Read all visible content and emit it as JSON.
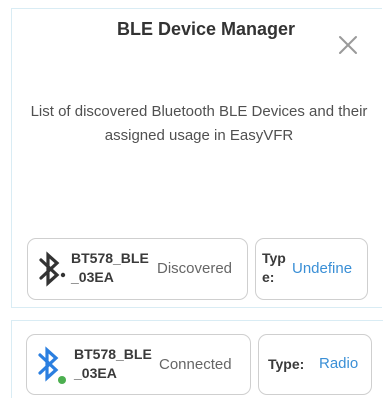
{
  "dialog": {
    "title": "BLE Device Manager",
    "description": "List of discovered Bluetooth BLE Devices and their assigned usage in EasyVFR"
  },
  "devices": [
    {
      "name": "BT578_BLE_03EA",
      "status": "Discovered",
      "icon": "bluetooth-icon",
      "icon_color": "#333333",
      "connected": false,
      "type_label": "Type:",
      "type_value": "Undefine"
    },
    {
      "name": "BT578_BLE_03EA",
      "status": "Connected",
      "icon": "bluetooth-icon",
      "icon_color": "#2b7fe0",
      "connected": true,
      "connected_dot_color": "#4caf50",
      "type_label": "Type:",
      "type_value": "Radio"
    }
  ],
  "colors": {
    "accent": "#3a8fd6",
    "panel_border": "#d9ecf4",
    "card_border": "#cfcfcf"
  }
}
